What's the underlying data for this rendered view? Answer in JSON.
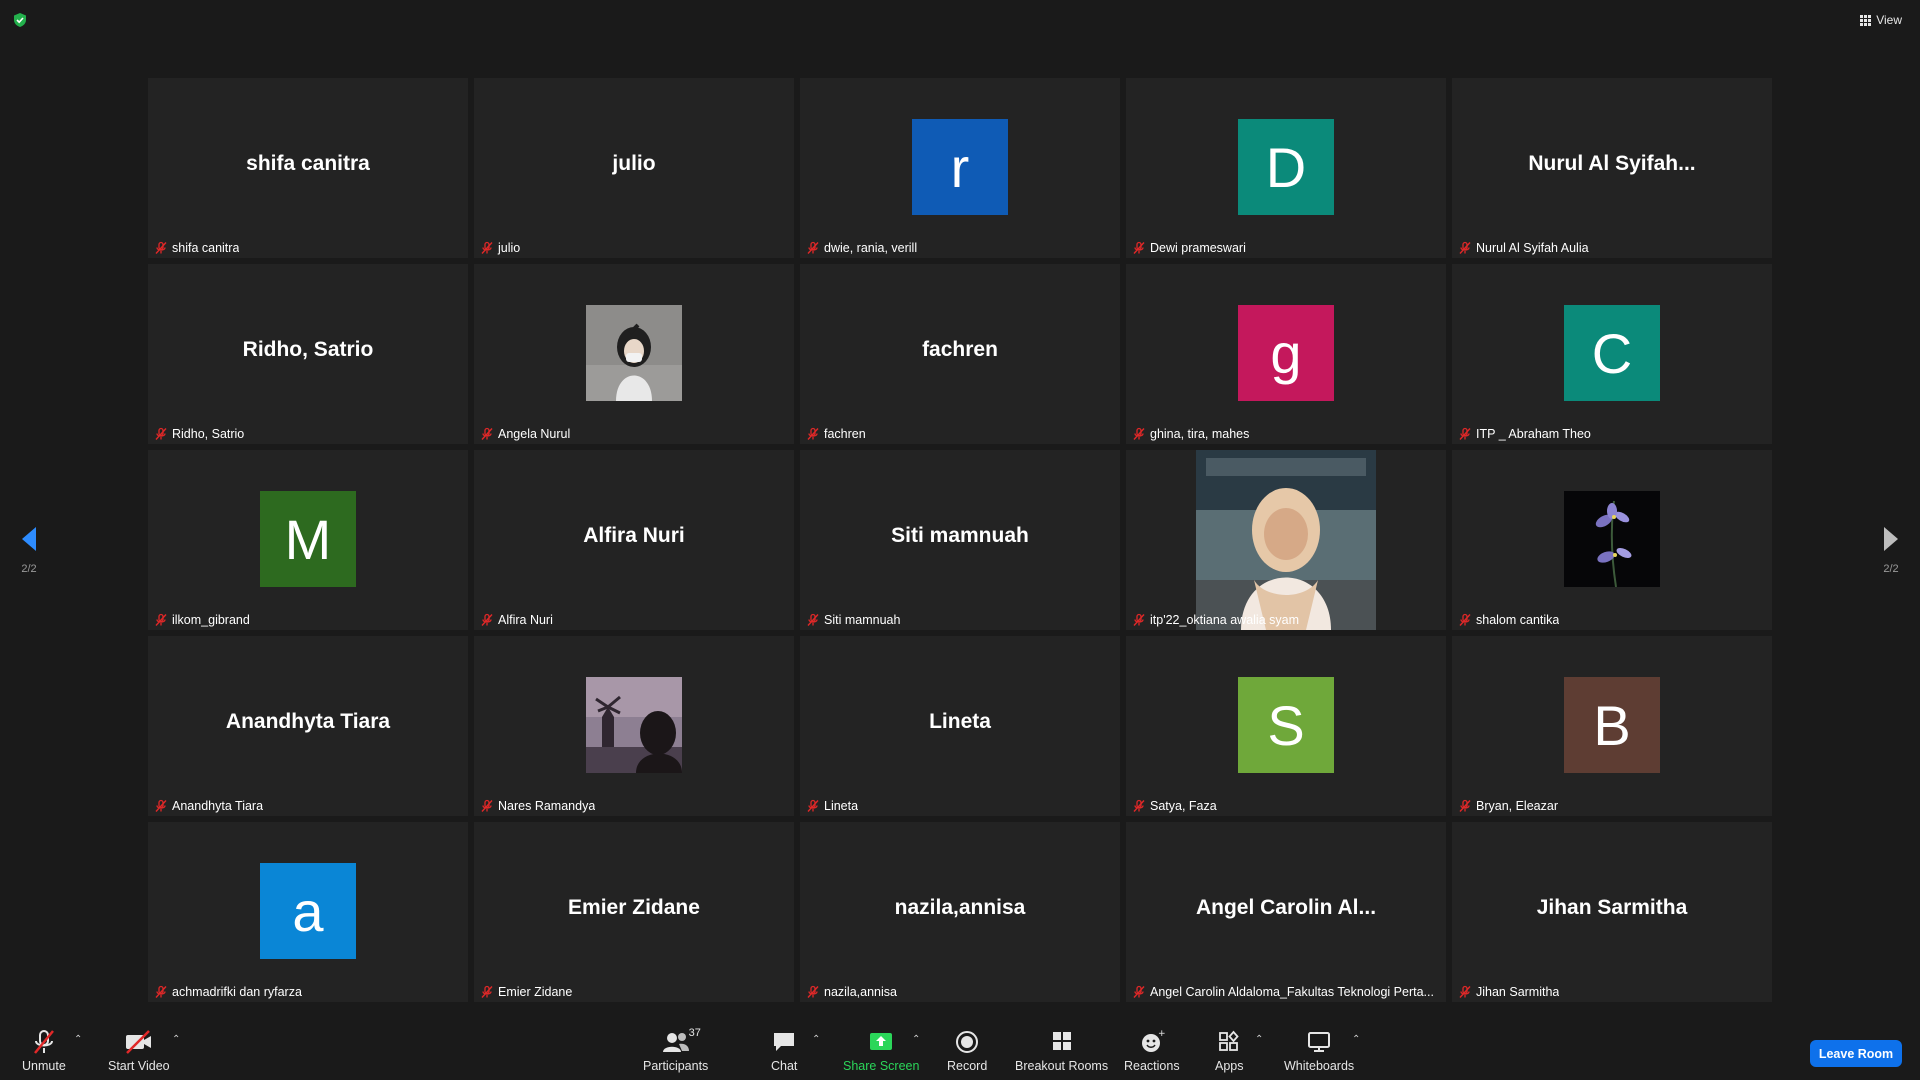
{
  "header": {
    "view_label": "View"
  },
  "pagination": {
    "left_label": "2/2",
    "right_label": "2/2"
  },
  "colors": {
    "accent": "#0e71eb",
    "share_green": "#2bd65a",
    "muted_mic": "#e02828"
  },
  "participants": [
    {
      "display": "shifa canitra",
      "name": "shifa canitra"
    },
    {
      "display": "julio",
      "name": "julio"
    },
    {
      "initial": "r",
      "color": "#0f5bb5",
      "name": "dwie, rania, verill"
    },
    {
      "initial": "D",
      "color": "#0b8a7a",
      "name": "Dewi prameswari"
    },
    {
      "display": "Nurul  Al  Syifah...",
      "name": "Nurul Al Syifah Aulia"
    },
    {
      "display": "Ridho, Satrio",
      "name": "Ridho, Satrio"
    },
    {
      "photo": "photo-a",
      "name": "Angela Nurul"
    },
    {
      "display": "fachren",
      "name": "fachren"
    },
    {
      "initial": "g",
      "color": "#c4185c",
      "name": "ghina, tira, mahes"
    },
    {
      "initial": "C",
      "color": "#0b8a7a",
      "name": "ITP _ Abraham Theo"
    },
    {
      "initial": "M",
      "color": "#2d6a1f",
      "name": "ilkom_gibrand"
    },
    {
      "display": "Alfira Nuri",
      "name": "Alfira Nuri"
    },
    {
      "display": "Siti mamnuah",
      "name": "Siti mamnuah"
    },
    {
      "photo": "photo-b",
      "name": "itp'22_oktiana awalia syam"
    },
    {
      "photo": "photo-c",
      "name": "shalom cantika"
    },
    {
      "display": "Anandhyta Tiara",
      "name": "Anandhyta Tiara"
    },
    {
      "photo": "photo-d",
      "name": "Nares Ramandya"
    },
    {
      "display": "Lineta",
      "name": "Lineta"
    },
    {
      "initial": "S",
      "color": "#6fa83a",
      "name": "Satya, Faza"
    },
    {
      "initial": "B",
      "color": "#5e3d33",
      "name": "Bryan, Eleazar"
    },
    {
      "initial": "a",
      "color": "#0a86d6",
      "name": "achmadrifki dan ryfarza"
    },
    {
      "display": "Emier Zidane",
      "name": "Emier Zidane"
    },
    {
      "display": "nazila,annisa",
      "name": "nazila,annisa"
    },
    {
      "display": "Angel  Carolin  Al...",
      "name": "Angel Carolin Aldaloma_Fakultas Teknologi Perta..."
    },
    {
      "display": "Jihan Sarmitha",
      "name": "Jihan Sarmitha"
    }
  ],
  "toolbar": {
    "unmute": "Unmute",
    "start_video": "Start Video",
    "participants": "Participants",
    "participants_count": "37",
    "chat": "Chat",
    "share_screen": "Share Screen",
    "record": "Record",
    "breakout_rooms": "Breakout Rooms",
    "reactions": "Reactions",
    "apps": "Apps",
    "whiteboards": "Whiteboards",
    "leave": "Leave Room"
  }
}
